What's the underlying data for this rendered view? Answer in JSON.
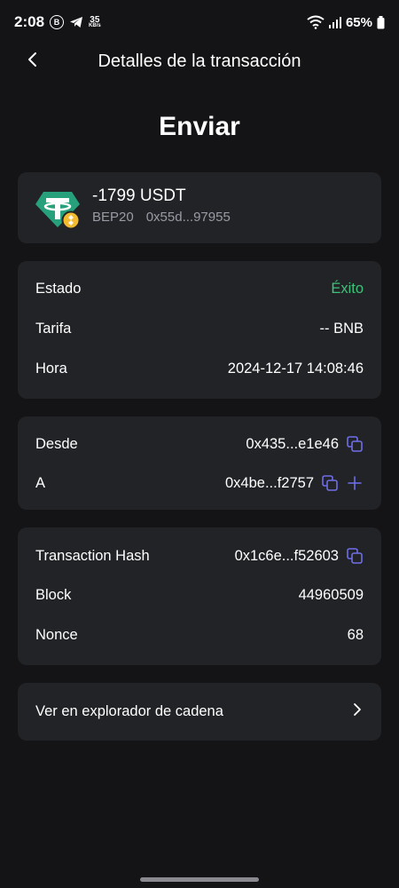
{
  "status_bar": {
    "time": "2:08",
    "b_badge": "B",
    "net_speed_value": "35",
    "net_speed_unit": "KB/s",
    "battery": "65%"
  },
  "header": {
    "title": "Detalles de la transacción",
    "back_icon": "chevron-left-icon"
  },
  "page_title": "Enviar",
  "asset": {
    "amount": "-1799 USDT",
    "network": "BEP20",
    "address": "0x55d...97955",
    "icon": "usdt-token-icon",
    "badge_icon": "bnb-badge-icon",
    "colors": {
      "usdt": "#26a17b",
      "bnb": "#f3ba2f"
    }
  },
  "details": {
    "status_label": "Estado",
    "status_value": "Éxito",
    "fee_label": "Tarifa",
    "fee_value": "-- BNB",
    "time_label": "Hora",
    "time_value": "2024-12-17 14:08:46"
  },
  "addresses": {
    "from_label": "Desde",
    "from_value": "0x435...e1e46",
    "to_label": "A",
    "to_value": "0x4be...f2757"
  },
  "chain_info": {
    "hash_label": "Transaction Hash",
    "hash_value": "0x1c6e...f52603",
    "block_label": "Block",
    "block_value": "44960509",
    "nonce_label": "Nonce",
    "nonce_value": "68"
  },
  "explorer": {
    "label": "Ver en explorador de cadena"
  },
  "colors": {
    "background": "#141416",
    "card": "#222326",
    "accent": "#6f6ee8",
    "success": "#3ec37b",
    "muted": "#9a9aa6"
  }
}
